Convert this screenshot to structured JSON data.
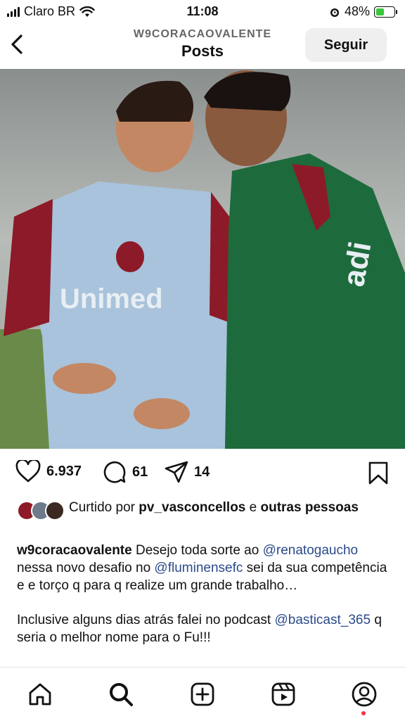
{
  "status_bar": {
    "carrier": "Claro BR",
    "time": "11:08",
    "battery": "48%",
    "battery_level": 0.48
  },
  "header": {
    "username": "W9CORACAOVALENTE",
    "title": "Posts",
    "follow_label": "Seguir"
  },
  "photo": {
    "jersey_text": "Unimed"
  },
  "actions": {
    "likes": "6.937",
    "comments": "61",
    "shares": "14"
  },
  "liked_by": {
    "prefix": "Curtido por ",
    "user": "pv_vasconcellos",
    "middle": " e ",
    "others": "outras pessoas"
  },
  "caption": {
    "username": "w9coracaovalente",
    "t1": " Desejo toda sorte ao ",
    "m1": "@renatogaucho",
    "t2": " nessa novo desafio no ",
    "m2": "@fluminensefc",
    "t3": " sei da sua competência e e torço q para q realize um grande trabalho…",
    "p2_text": "Inclusive alguns dias atrás falei no podcast ",
    "m3": "@basticast_365",
    "p2_end": " q seria o melhor nome para o Fu!!!"
  },
  "colors": {
    "mention": "#2b4a8a",
    "notification_dot": "#ff3040",
    "battery_fill": "#3cc83c"
  }
}
